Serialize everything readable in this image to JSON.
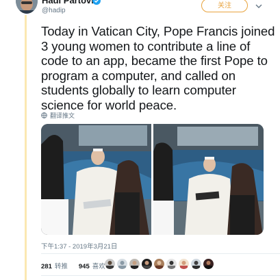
{
  "author": {
    "name": "Hadi Partovi",
    "handle": "@hadip",
    "follow_label": "关注"
  },
  "tweet": {
    "text": "Today in Vatican City, Pope Francis joined 3 young women to contribute a line of code to an app, became the first Pope to program a computer, and called on students globally to learn computer science for world peace.",
    "translate_label": "翻译推文"
  },
  "meta": {
    "timestamp": "下午1:37 - 2019年3月21日"
  },
  "stats": {
    "retweets_count": "281",
    "retweets_label": "转推",
    "likes_count": "945",
    "likes_label": "喜欢"
  },
  "colors": {
    "accent": "#e8a33d",
    "verified": "#1da1f2",
    "secondary_text": "#657786"
  }
}
